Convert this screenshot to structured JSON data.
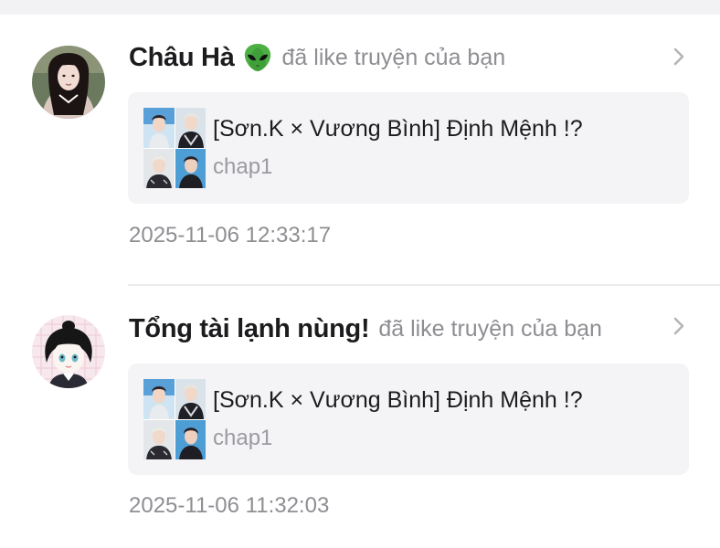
{
  "notifications": [
    {
      "user": "Châu Hà",
      "emoji": "alien-emoji",
      "action": "đã like truyện của bạn",
      "story_title": "[Sơn.K × Vương Bình] Định Mệnh !?",
      "chapter": "chap1",
      "timestamp": "2025-11-06 12:33:17"
    },
    {
      "user": "Tổng tài lạnh nùng!",
      "action": "đã like truyện của bạn",
      "story_title": "[Sơn.K × Vương Bình] Định Mệnh !?",
      "chapter": "chap1",
      "timestamp": "2025-11-06 11:32:03"
    }
  ],
  "colors": {
    "name": "#1c1c1e",
    "secondary": "#8e8e93",
    "card_bg": "#f4f4f6",
    "alien_green": "#3fa03a"
  }
}
